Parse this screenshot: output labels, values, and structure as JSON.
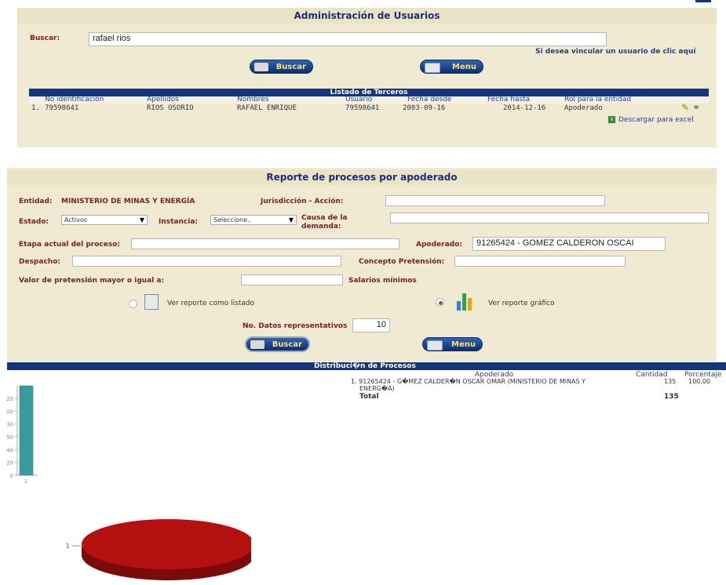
{
  "admin": {
    "title": "Administración de Usuarios",
    "search_label": "Buscar:",
    "search_value": "rafael rios",
    "link_text": "Si desea vincular un usuario de clic aquí",
    "buscar_btn": "Buscar",
    "menu_btn": "Menu",
    "table_title": "Listado de Terceros",
    "columns": [
      "No identificación",
      "Apellidos",
      "Nombres",
      "Usuario",
      "Fecha desde",
      "Fecha hasta",
      "Rol para la entidad"
    ],
    "row": {
      "num": "1.",
      "id": "79598641",
      "apellidos": "RIOS OSORIO",
      "nombres": "RAFAEL ENRIQUE",
      "usuario": "79598641",
      "desde": "2003-09-16",
      "hasta": "2014-12-16",
      "rol": "Apoderado"
    },
    "excel_link": "Descargar para excel"
  },
  "report": {
    "title": "Reporte de procesos por apoderado",
    "entidad_label": "Entidad:",
    "entidad_value": "MINISTERIO DE MINAS Y ENERGÍA",
    "jurisdiccion_label": "Jurisdicción - Acción:",
    "estado_label": "Estado:",
    "estado_value": "Activos",
    "instancia_label": "Instancia:",
    "instancia_value": "Seleccione..",
    "causa_label_1": "Causa de la",
    "causa_label_2": "demanda:",
    "etapa_label": "Etapa actual del proceso:",
    "apoderado_label": "Apoderado:",
    "apoderado_value": "91265424 - GOMEZ CALDERON OSCAI",
    "despacho_label": "Despacho:",
    "concepto_label": "Concepto Pretensión:",
    "valor_label": "Valor de pretensión mayor o igual a:",
    "salarios_label": "Salarios mínimos",
    "radio_listado": "Ver reporte como listado",
    "radio_grafico": "Ver reporte gráfico",
    "ndatos_label": "No. Datos representativos",
    "ndatos_value": "10",
    "buscar_btn": "Buscar",
    "menu_btn": "Menu"
  },
  "distribution": {
    "title": "Distribuci�n de Procesos",
    "col_apoderado": "Apoderado",
    "col_cantidad": "Cantidad",
    "col_porcentaje": "Porcentaje",
    "row_line1": "1. 91265424 - G�MEZ CALDER�N OSCAR OMAR (MINISTERIO DE MINAS Y",
    "row_line2": "ENERG�A)",
    "row_cantidad": "135",
    "row_porcentaje": "100.00",
    "total_label": "Total",
    "total_value": "135"
  },
  "chart_data": [
    {
      "type": "bar",
      "categories": [
        "1"
      ],
      "values": [
        135
      ],
      "y_tick_labels": [
        "20",
        "00",
        "30",
        "50",
        "40",
        "20",
        "0"
      ],
      "color": "#3b9a9c"
    },
    {
      "type": "pie",
      "labels": [
        "1"
      ],
      "values": [
        135
      ],
      "color": "#b51010"
    }
  ],
  "colors": {
    "panel": "#f1ead3",
    "title_text": "#1d2f7a",
    "label_red": "#7a2222",
    "navy": "#13357a",
    "button_text": "#ffe64a",
    "excel_green": "#2e8b3a",
    "edit_pencil": "#7a9a00"
  }
}
